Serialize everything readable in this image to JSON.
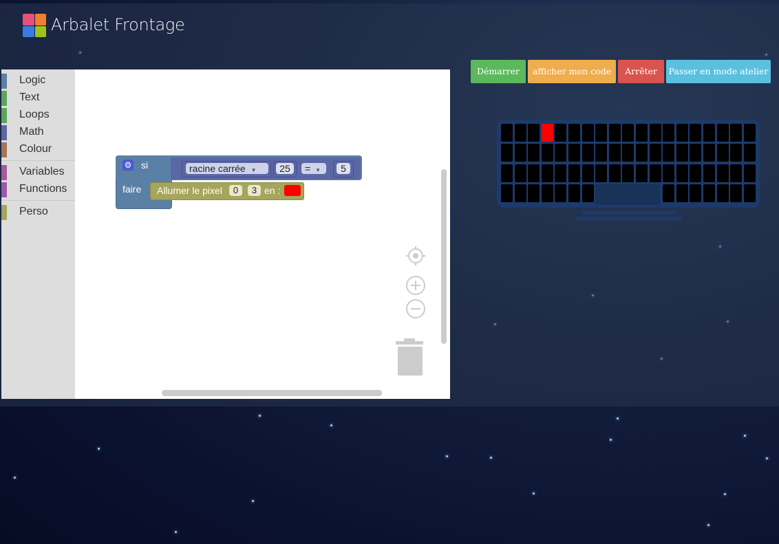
{
  "app": {
    "title": "Arbalet Frontage"
  },
  "toolbox": {
    "groups": [
      [
        {
          "label": "Logic",
          "color": "#5b80a5"
        },
        {
          "label": "Text",
          "color": "#5ba55b"
        },
        {
          "label": "Loops",
          "color": "#5ba55b"
        },
        {
          "label": "Math",
          "color": "#5b67a5"
        },
        {
          "label": "Colour",
          "color": "#a5745b"
        }
      ],
      [
        {
          "label": "Variables",
          "color": "#a55b99"
        },
        {
          "label": "Functions",
          "color": "#995ba5"
        }
      ],
      [
        {
          "label": "Perso",
          "color": "#a5a55b"
        }
      ]
    ]
  },
  "blocks": {
    "if_label": "si",
    "do_label": "faire",
    "compare": {
      "func": "racine carrée",
      "func_arg": "25",
      "operator": "=",
      "rhs": "5"
    },
    "pixel": {
      "label": "Allumer le pixel",
      "x": "0",
      "y": "3",
      "color_label": "en :",
      "color": "#ff0000"
    }
  },
  "buttons": {
    "start": "Démarrer",
    "show_code": "afficher mon code",
    "stop": "Arrêter",
    "workshop_mode": "Passer en mode atelier"
  },
  "facade": {
    "cols": 19,
    "rows": 4,
    "lit_pixels": [
      {
        "row": 0,
        "col": 3,
        "color": "#ff0000"
      }
    ]
  },
  "icons": [
    "logo-icon",
    "gear-icon",
    "recenter-icon",
    "zoom-in-icon",
    "zoom-out-icon",
    "trash-icon",
    "dropdown-arrow-icon"
  ]
}
